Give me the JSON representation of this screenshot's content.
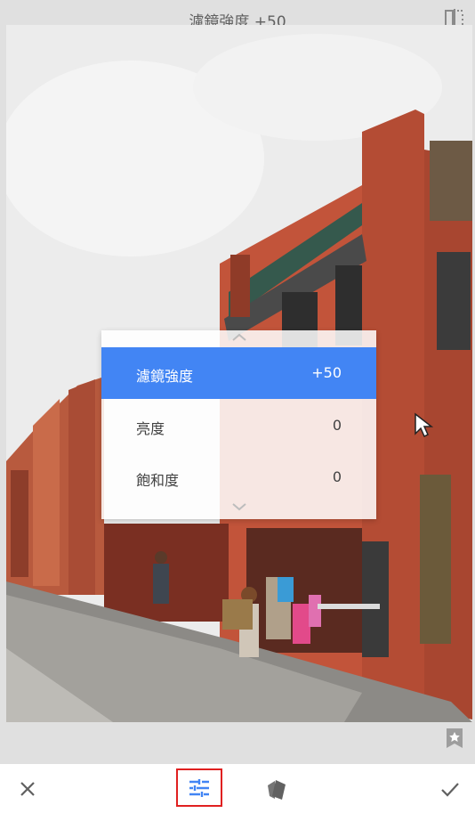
{
  "header": {
    "title": "濾鏡強度 +50",
    "compare_icon": "compare-split-icon"
  },
  "adjust_panel": {
    "items": [
      {
        "label": "濾鏡強度",
        "value": "+50",
        "selected": true
      },
      {
        "label": "亮度",
        "value": "0",
        "selected": false
      },
      {
        "label": "飽和度",
        "value": "0",
        "selected": false
      }
    ],
    "accent_color": "#4285f4"
  },
  "photo": {
    "description_icon": "edited-photo-image"
  },
  "bottom_bar": {
    "cancel_icon": "close-icon",
    "tools_icon": "tune-sliders-icon",
    "styles_icon": "styles-cards-icon",
    "apply_icon": "check-icon",
    "highlight_color": "#e02020"
  },
  "styles_star_icon": "star-bookmark-icon"
}
